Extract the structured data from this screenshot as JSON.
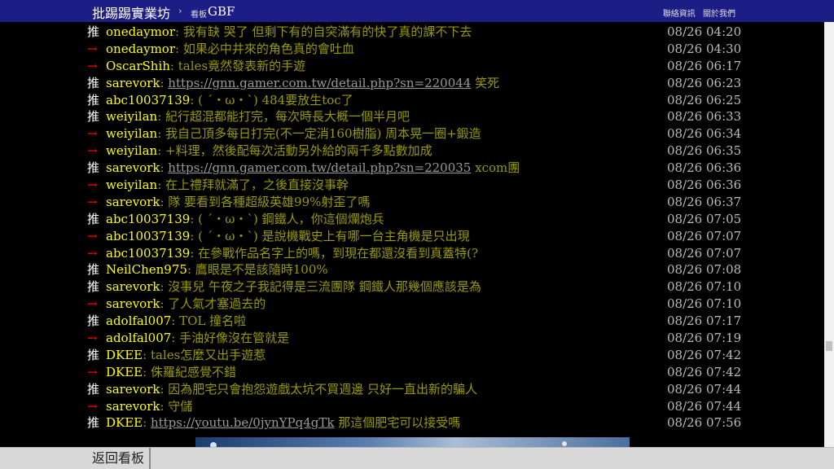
{
  "header": {
    "board_title": "批踢踢實業坊",
    "separator": "›",
    "board_label": "看板",
    "board_name": "GBF",
    "contact_link": "聯絡資訊",
    "about_link": "關於我們"
  },
  "pushes": [
    {
      "tag": "推",
      "type": "good",
      "user": "onedaymor",
      "content": ": 我有缺 哭了 但剩下有的自突滿有的快了真的課不下去",
      "time": "08/26 04:20"
    },
    {
      "tag": "→",
      "type": "arrow",
      "user": "onedaymor",
      "content": ": 如果必中井來的角色真的會吐血",
      "time": "08/26 04:30"
    },
    {
      "tag": "→",
      "type": "arrow",
      "user": "OscarShih",
      "content": ": tales竟然發表新的手遊",
      "time": "08/26 06:17"
    },
    {
      "tag": "推",
      "type": "good",
      "user": "sarevork",
      "content": ": ",
      "link": "https://gnn.gamer.com.tw/detail.php?sn=220044",
      "after": " 笑死",
      "time": "08/26 06:23"
    },
    {
      "tag": "推",
      "type": "good",
      "user": "abc10037139",
      "content": ": ( ˊ・ω・ˋ) 484要放生toc了",
      "time": "08/26 06:25"
    },
    {
      "tag": "推",
      "type": "good",
      "user": "weiyilan",
      "content": ": 紀行超混都能打完，每次時長大概一個半月吧",
      "time": "08/26 06:33"
    },
    {
      "tag": "→",
      "type": "arrow",
      "user": "weiyilan",
      "content": ": 我自己頂多每日打完(不一定消160樹脂) 周本晃一圈+鍛造",
      "time": "08/26 06:34"
    },
    {
      "tag": "→",
      "type": "arrow",
      "user": "weiyilan",
      "content": ": +料理，然後配每次活動另外給的兩千多點數加成",
      "time": "08/26 06:35"
    },
    {
      "tag": "推",
      "type": "good",
      "user": "sarevork",
      "content": ": ",
      "link": "https://gnn.gamer.com.tw/detail.php?sn=220035",
      "after": " xcom團",
      "time": "08/26 06:36"
    },
    {
      "tag": "→",
      "type": "arrow",
      "user": "weiyilan",
      "content": ": 在上禮拜就滿了，之後直接沒事幹",
      "time": "08/26 06:36"
    },
    {
      "tag": "→",
      "type": "arrow",
      "user": "sarevork",
      "content": ": 隊 要看到各種超級英雄99%射歪了嗎",
      "time": "08/26 06:37"
    },
    {
      "tag": "推",
      "type": "good",
      "user": "abc10037139",
      "content": ": ( ˊ・ω・ˋ) 鋼鐵人，你這個爛炮兵",
      "time": "08/26 07:05"
    },
    {
      "tag": "→",
      "type": "arrow",
      "user": "abc10037139",
      "content": ": ( ˊ・ω・ˋ) 是說機戰史上有哪一台主角機是只出現",
      "time": "08/26 07:07"
    },
    {
      "tag": "→",
      "type": "arrow",
      "user": "abc10037139",
      "content": ": 在參戰作品名字上的嗎，到現在都還沒看到真蓋特(?",
      "time": "08/26 07:07"
    },
    {
      "tag": "推",
      "type": "good",
      "user": "NeilChen975",
      "content": ": 鷹眼是不是該隨時100%",
      "time": "08/26 07:08"
    },
    {
      "tag": "推",
      "type": "good",
      "user": "sarevork",
      "content": ": 沒事兒 午夜之子我記得是三流團隊 鋼鐵人那幾個應該是為",
      "time": "08/26 07:10"
    },
    {
      "tag": "→",
      "type": "arrow",
      "user": "sarevork",
      "content": ": 了人氣才塞過去的",
      "time": "08/26 07:10"
    },
    {
      "tag": "推",
      "type": "good",
      "user": "adolfal007",
      "content": ": TOL 撞名啦",
      "time": "08/26 07:17"
    },
    {
      "tag": "→",
      "type": "arrow",
      "user": "adolfal007",
      "content": ": 手油好像沒在管就是",
      "time": "08/26 07:19"
    },
    {
      "tag": "推",
      "type": "good",
      "user": "DKEE",
      "content": ": tales怎麼又出手遊惹",
      "time": "08/26 07:42"
    },
    {
      "tag": "→",
      "type": "arrow",
      "user": "DKEE",
      "content": ": 侏羅紀感覺不錯",
      "time": "08/26 07:42"
    },
    {
      "tag": "推",
      "type": "good",
      "user": "sarevork",
      "content": ": 因為肥宅只會抱怨遊戲太坑不買週邊 只好一直出新的騙人",
      "time": "08/26 07:44"
    },
    {
      "tag": "→",
      "type": "arrow",
      "user": "sarevork",
      "content": ": 守儲",
      "time": "08/26 07:44"
    },
    {
      "tag": "推",
      "type": "good",
      "user": "DKEE",
      "content": ": ",
      "link": "https://youtu.be/0jynYPq4gTk",
      "after": " 那這個肥宅可以接受嗎",
      "time": "08/26 07:56"
    }
  ],
  "footer": {
    "back_label": "返回看板"
  }
}
